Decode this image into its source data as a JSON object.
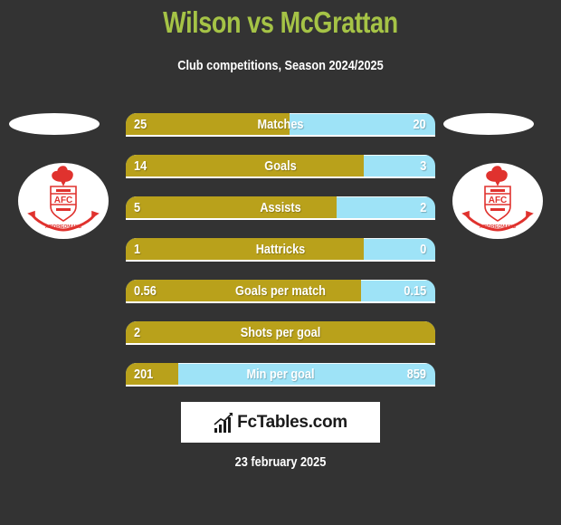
{
  "header": {
    "title": "Wilson vs McGrattan",
    "subtitle": "Club competitions, Season 2024/2025"
  },
  "players": {
    "left": {
      "name": "Wilson",
      "club_logo": "airdrieonians-crest",
      "crest_text": "AFC",
      "crest_banner": "AIRDRIEONIANS"
    },
    "right": {
      "name": "McGrattan",
      "club_logo": "airdrieonians-crest",
      "crest_text": "AFC",
      "crest_banner": "AIRDRIEONIANS"
    }
  },
  "colors": {
    "background": "#333333",
    "title": "#a5c346",
    "left_bar": "#b9a11b",
    "right_bar": "#9ee3f7",
    "crest_red": "#e0322e"
  },
  "stats": [
    {
      "label": "Matches",
      "left": "25",
      "right": "20",
      "left_share": 0.53
    },
    {
      "label": "Goals",
      "left": "14",
      "right": "3",
      "left_share": 0.77
    },
    {
      "label": "Assists",
      "left": "5",
      "right": "2",
      "left_share": 0.68
    },
    {
      "label": "Hattricks",
      "left": "1",
      "right": "0",
      "left_share": 0.77
    },
    {
      "label": "Goals per match",
      "left": "0.56",
      "right": "0.15",
      "left_share": 0.76
    },
    {
      "label": "Shots per goal",
      "left": "2",
      "right": "",
      "left_share": 1.0
    },
    {
      "label": "Min per goal",
      "left": "201",
      "right": "859",
      "left_share": 0.17
    }
  ],
  "brand": {
    "name": "FcTables.com",
    "icon": "bar-chart-icon"
  },
  "footer": {
    "date": "23 february 2025"
  }
}
